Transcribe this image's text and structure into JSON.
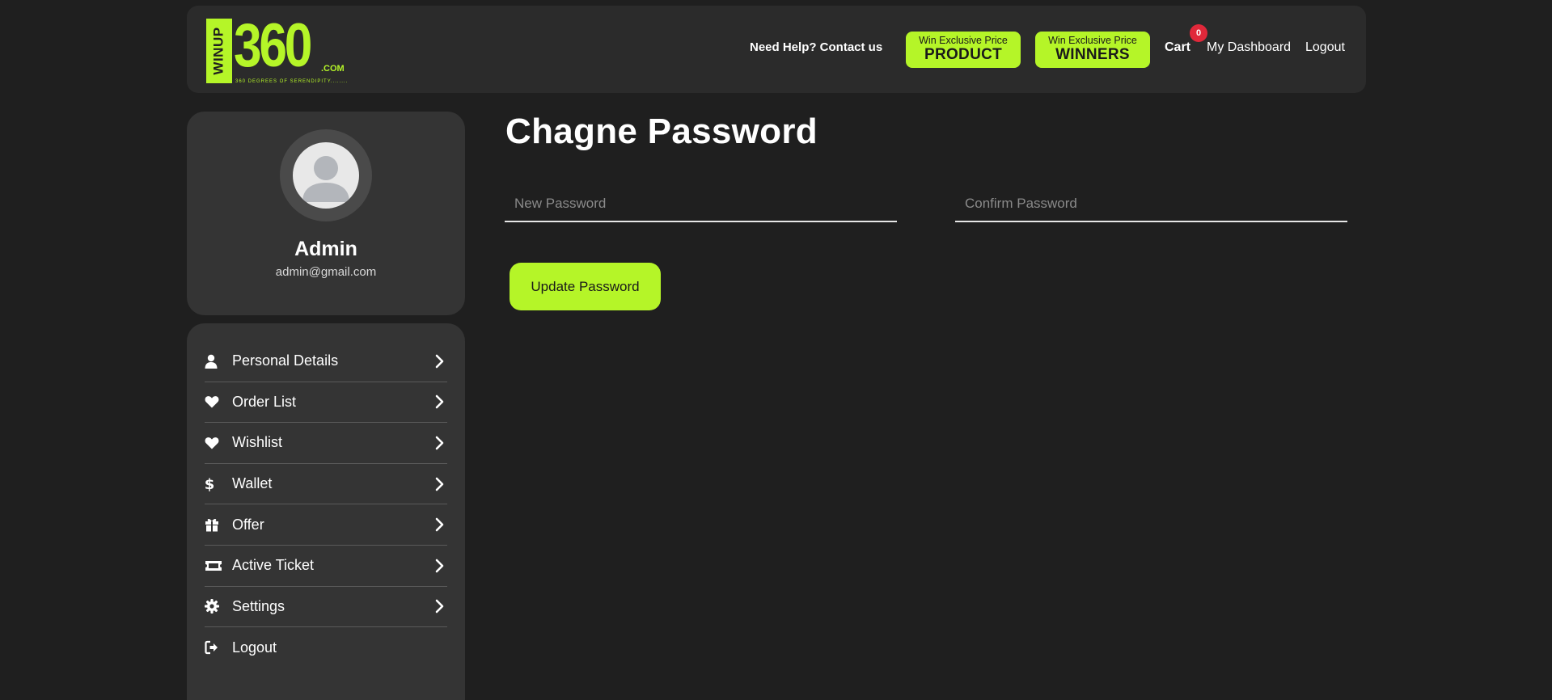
{
  "header": {
    "logo": {
      "vertical_text": "WINUP",
      "number": "360",
      "domain": ".COM",
      "tagline": "360 DEGREES OF SERENDIPITY........"
    },
    "help_link": "Need Help? Contact us",
    "promo_product": {
      "small": "Win Exclusive Price",
      "big": "PRODUCT"
    },
    "promo_winners": {
      "small": "Win Exclusive Price",
      "big": "WINNERS"
    },
    "cart_label": "Cart",
    "cart_count": "0",
    "dashboard_label": "My Dashboard",
    "logout_label": "Logout"
  },
  "profile": {
    "name": "Admin",
    "email": "admin@gmail.com"
  },
  "menu": {
    "items": [
      {
        "label": "Personal Details",
        "icon": "user-icon"
      },
      {
        "label": "Order List",
        "icon": "heart-icon"
      },
      {
        "label": "Wishlist",
        "icon": "heart-icon"
      },
      {
        "label": "Wallet",
        "icon": "dollar-icon"
      },
      {
        "label": "Offer",
        "icon": "gift-icon"
      },
      {
        "label": "Active Ticket",
        "icon": "ticket-icon"
      },
      {
        "label": "Settings",
        "icon": "gear-icon"
      },
      {
        "label": "Logout",
        "icon": "sign-out-icon"
      }
    ]
  },
  "main": {
    "title": "Chagne Password",
    "new_password_placeholder": "New Password",
    "confirm_password_placeholder": "Confirm Password",
    "update_button": "Update Password"
  },
  "colors": {
    "background": "#1f1f1f",
    "card": "#343434",
    "header": "#2b2b2b",
    "accent": "#b5f528",
    "badge": "#e0283a"
  }
}
